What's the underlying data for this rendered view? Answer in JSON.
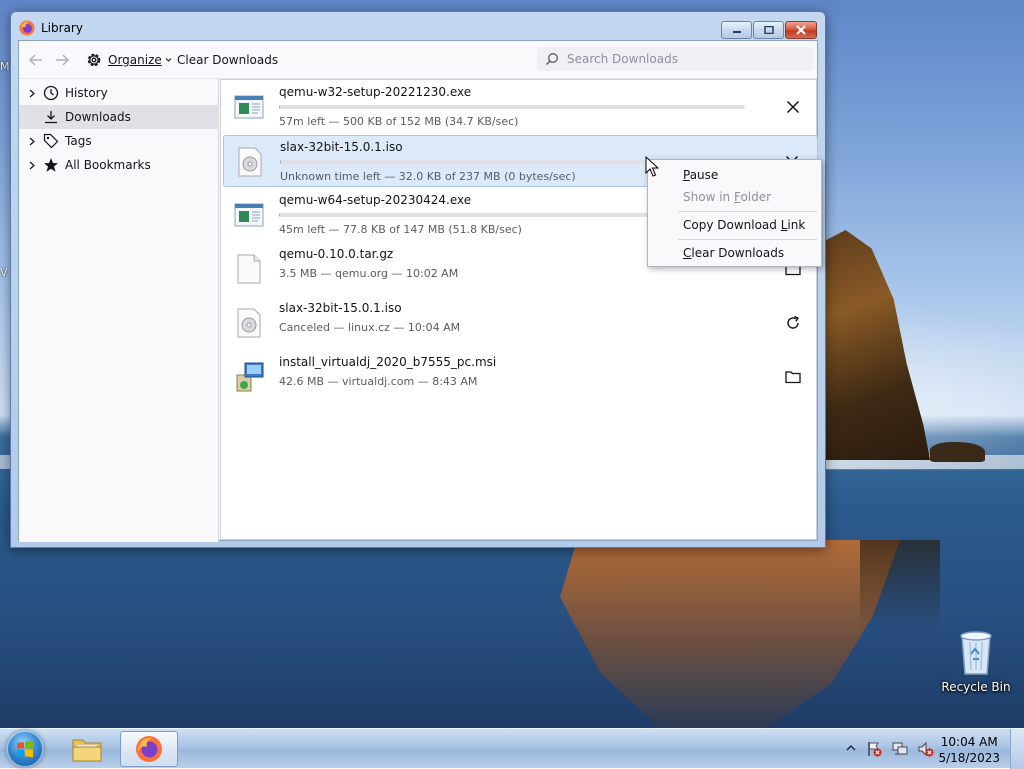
{
  "desktop": {
    "edge_letters": [
      "M",
      "V"
    ],
    "recycle_bin": {
      "label": "Recycle Bin"
    }
  },
  "window": {
    "title": "Library",
    "toolbar": {
      "organize_label": "Organize",
      "clear_downloads_label": "Clear Downloads",
      "search_placeholder": "Search Downloads"
    },
    "sidebar": {
      "items": [
        {
          "label": "History",
          "icon": "clock-icon",
          "expandable": true
        },
        {
          "label": "Downloads",
          "icon": "download-icon",
          "expandable": false,
          "selected": true
        },
        {
          "label": "Tags",
          "icon": "tag-icon",
          "expandable": true
        },
        {
          "label": "All Bookmarks",
          "icon": "star-icon",
          "expandable": true
        }
      ]
    },
    "downloads": [
      {
        "name": "qemu-w32-setup-20221230.exe",
        "status": "57m left — 500 KB of 152 MB (34.7 KB/sec)",
        "progress": 0.003,
        "icon": "exe-icon",
        "action": "cancel-icon"
      },
      {
        "name": "slax-32bit-15.0.1.iso",
        "status": "Unknown time left — 32.0 KB of 237 MB (0 bytes/sec)",
        "progress": 0.0,
        "icon": "disc-image-icon",
        "action": "cancel-icon",
        "selected": true
      },
      {
        "name": "qemu-w64-setup-20230424.exe",
        "status": "45m left — 77.8 KB of 147 MB (51.8 KB/sec)",
        "progress": 0.0005,
        "icon": "exe-icon",
        "action": "cancel-icon"
      },
      {
        "name": "qemu-0.10.0.tar.gz",
        "status": "3.5 MB — qemu.org — 10:02 AM",
        "icon": "file-icon",
        "action": "folder-icon"
      },
      {
        "name": "slax-32bit-15.0.1.iso",
        "status": "Canceled — linux.cz — 10:04 AM",
        "icon": "disc-image-icon",
        "action": "retry-icon"
      },
      {
        "name": "install_virtualdj_2020_b7555_pc.msi",
        "status": "42.6 MB — virtualdj.com — 8:43 AM",
        "icon": "installer-icon",
        "action": "folder-icon"
      }
    ],
    "context_menu": {
      "items": [
        {
          "label": "Pause",
          "access_key": "P",
          "enabled": true
        },
        {
          "label": "Show in Folder",
          "access_key": "F",
          "enabled": false
        },
        {
          "label": "Copy Download Link",
          "access_key": "L",
          "enabled": true
        },
        {
          "label": "Clear Downloads",
          "access_key": "C",
          "enabled": true
        }
      ]
    }
  },
  "taskbar": {
    "apps": [
      {
        "name": "file-explorer",
        "active": false
      },
      {
        "name": "firefox",
        "active": true
      }
    ],
    "clock": {
      "time": "10:04 AM",
      "date": "5/18/2023"
    }
  },
  "colors": {
    "accent": "#0061e0",
    "selected_row": "#dce9f8",
    "window_frame": "#b2cbea"
  }
}
